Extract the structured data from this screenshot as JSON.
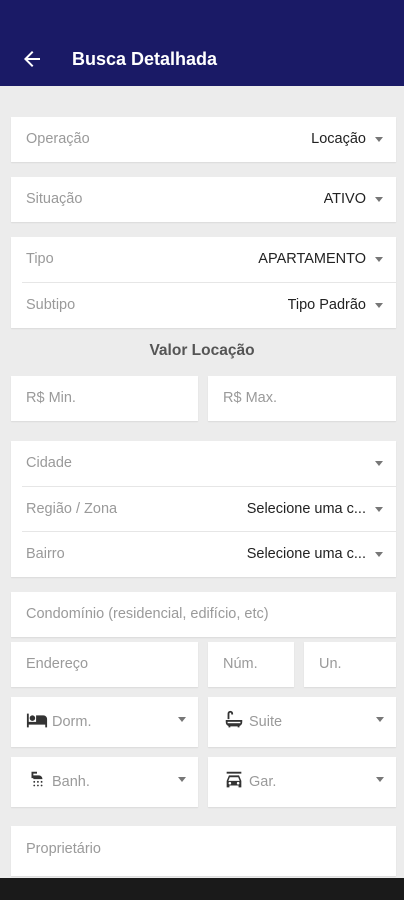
{
  "header": {
    "title": "Busca Detalhada",
    "back_icon": "arrow-left-icon"
  },
  "operacao": {
    "label": "Operação",
    "value": "Locação"
  },
  "situacao": {
    "label": "Situação",
    "value": "ATIVO"
  },
  "tipo": {
    "label": "Tipo",
    "value": "APARTAMENTO"
  },
  "subtipo": {
    "label": "Subtipo",
    "value": "Tipo Padrão"
  },
  "valor_section": {
    "title": "Valor Locação",
    "min_placeholder": "R$ Min.",
    "max_placeholder": "R$ Max."
  },
  "cidade": {
    "label": "Cidade",
    "value": ""
  },
  "regiao": {
    "label": "Região / Zona",
    "value": "Selecione uma c..."
  },
  "bairro": {
    "label": "Bairro",
    "value": "Selecione uma c..."
  },
  "condominio": {
    "placeholder": "Condomínio (residencial, edifício, etc)"
  },
  "endereco": {
    "placeholder": "Endereço",
    "numero_placeholder": "Núm.",
    "unidade_placeholder": "Un."
  },
  "dorm": {
    "placeholder": "Dorm.",
    "icon": "bed-icon"
  },
  "suite": {
    "placeholder": "Suite",
    "icon": "bathtub-icon"
  },
  "banh": {
    "placeholder": "Banh.",
    "icon": "shower-icon"
  },
  "gar": {
    "placeholder": "Gar.",
    "icon": "car-icon"
  },
  "proprietario": {
    "placeholder": "Proprietário"
  },
  "colors": {
    "appbar": "#1a1a66",
    "background": "#ececec",
    "card": "#ffffff"
  }
}
